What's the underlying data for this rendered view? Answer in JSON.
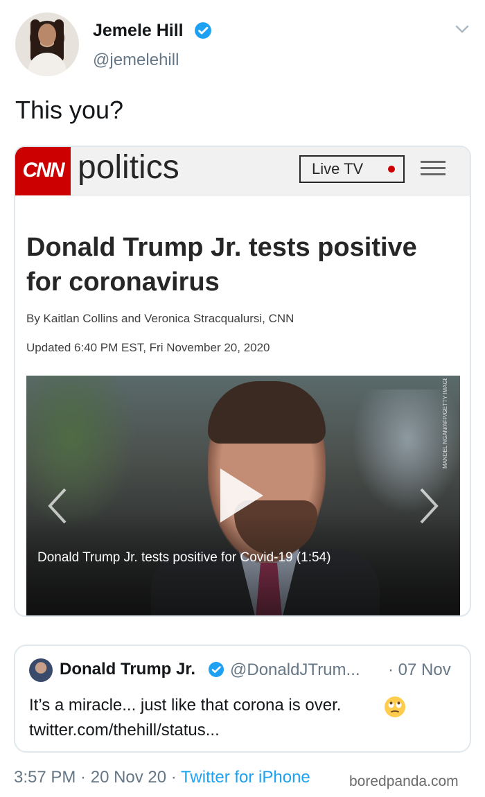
{
  "author": {
    "name": "Jemele Hill",
    "handle": "@jemelehill"
  },
  "tweet_text": "This you?",
  "embedded": {
    "brand_logo": "CNN",
    "section": "politics",
    "live_tv_label": "Live TV",
    "headline": "Donald Trump Jr. tests positive for coronavirus",
    "byline": "By Kaitlan Collins and Veronica Stracqualursi, CNN",
    "updated": "Updated 6:40 PM EST, Fri November 20, 2020",
    "video_caption": "Donald Trump Jr. tests positive for Covid-19 (1:54)",
    "photo_credit": "MANDEL NGAN/AFP/GETTY IMAGES"
  },
  "quoted_tweet": {
    "name": "Donald Trump Jr.",
    "handle": "@DonaldJTrum...",
    "date": "· 07 Nov",
    "text_line1": "It’s a miracle... just like that corona is over.",
    "text_line2": "twitter.com/thehill/status..."
  },
  "footer": {
    "time": "3:57 PM",
    "sep1": " · ",
    "date": "20 Nov 20",
    "sep2": " · ",
    "source": "Twitter for iPhone"
  },
  "watermark": "boredpanda.com",
  "colors": {
    "twitter_blue": "#1da1f2",
    "cnn_red": "#cc0000",
    "muted": "#657786"
  },
  "icons": {
    "verified": "verified-badge-icon",
    "menu": "chevron-down-icon",
    "play": "play-icon",
    "emoji": "rolling-eyes-emoji-icon"
  }
}
